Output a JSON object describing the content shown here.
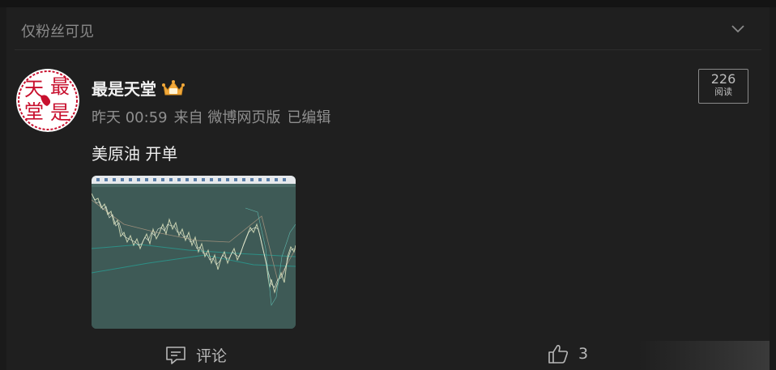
{
  "visibility": {
    "label": "仅粉丝可见"
  },
  "post": {
    "author": "最是天堂",
    "avatar_text": [
      "天",
      "最",
      "堂",
      "是"
    ],
    "time": "昨天 00:59",
    "source": "来自 微博网页版",
    "edited": "已编辑",
    "text": "美原油 开单",
    "read_count": "226",
    "read_label": "阅读"
  },
  "actions": {
    "comment_label": "评论",
    "like_count": "3"
  },
  "colors": {
    "background": "#1a1a1a",
    "card": "#1f1f1f",
    "avatar_red": "#c8102e",
    "chart_bg": "#3e5a56",
    "crown": "#f2a93b"
  },
  "icons": {
    "chevron": "chevron-down-icon",
    "crown": "crown-icon",
    "comment": "comment-icon",
    "like": "thumbs-up-icon"
  }
}
